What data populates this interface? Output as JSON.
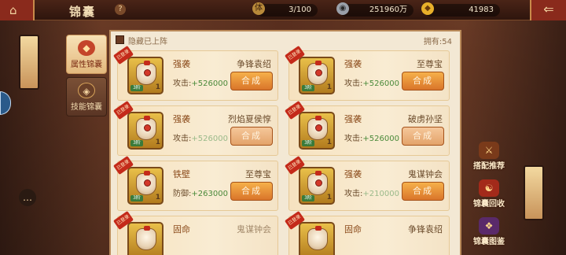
{
  "topbar": {
    "title": "锦囊",
    "help": "?",
    "res1": {
      "icon": "体",
      "value": "3/100"
    },
    "res2": {
      "icon": "◉",
      "value": "251960万"
    },
    "res3": {
      "icon": "◆",
      "value": "41983"
    },
    "back": "⇐"
  },
  "tabs": [
    {
      "label": "属性锦囊",
      "icon": "◆"
    },
    {
      "label": "技能锦囊",
      "icon": "◈"
    }
  ],
  "panel": {
    "hide_equipped": "隐藏已上阵",
    "owned": "拥有:54"
  },
  "cards": [
    {
      "ribbon": "已登录",
      "name": "强袭",
      "hero": "争锋袁绍",
      "stat_label": "攻击:",
      "stat_value": "+526000",
      "count": "1",
      "stars": "3阶",
      "button": "合成"
    },
    {
      "ribbon": "已登录",
      "name": "强袭",
      "hero": "至尊宝",
      "stat_label": "攻击:",
      "stat_value": "+526000",
      "count": "1",
      "stars": "3阶",
      "button": "合成"
    },
    {
      "ribbon": "已登录",
      "name": "强袭",
      "hero": "烈焰夏侯惇",
      "stat_label": "攻击:",
      "stat_value": "+526000",
      "count": "1",
      "stars": "3阶",
      "button": "合成"
    },
    {
      "ribbon": "已登录",
      "name": "强袭",
      "hero": "破虏孙坚",
      "stat_label": "攻击:",
      "stat_value": "+526000",
      "count": "1",
      "stars": "3阶",
      "button": "合成"
    },
    {
      "ribbon": "已登录",
      "name": "铁壁",
      "hero": "至尊宝",
      "stat_label": "防御:",
      "stat_value": "+263000",
      "count": "1",
      "stars": "3阶",
      "button": "合成"
    },
    {
      "ribbon": "已登录",
      "name": "强袭",
      "hero": "鬼谋钟会",
      "stat_label": "攻击:",
      "stat_value": "+210000",
      "count": "1",
      "stars": "3阶",
      "button": "合成"
    },
    {
      "ribbon": "已登录",
      "name": "固命",
      "hero": "鬼谋钟会",
      "stat_label": "",
      "stat_value": "",
      "count": "",
      "stars": "",
      "button": ""
    },
    {
      "ribbon": "已登录",
      "name": "固命",
      "hero": "争锋袁绍",
      "stat_label": "",
      "stat_value": "",
      "count": "",
      "stars": "",
      "button": ""
    }
  ],
  "side_buttons": [
    {
      "label": "搭配推荐",
      "icon": "⚔"
    },
    {
      "label": "锦囊回收",
      "icon": "☯"
    },
    {
      "label": "锦囊图鉴",
      "icon": "❖"
    }
  ]
}
